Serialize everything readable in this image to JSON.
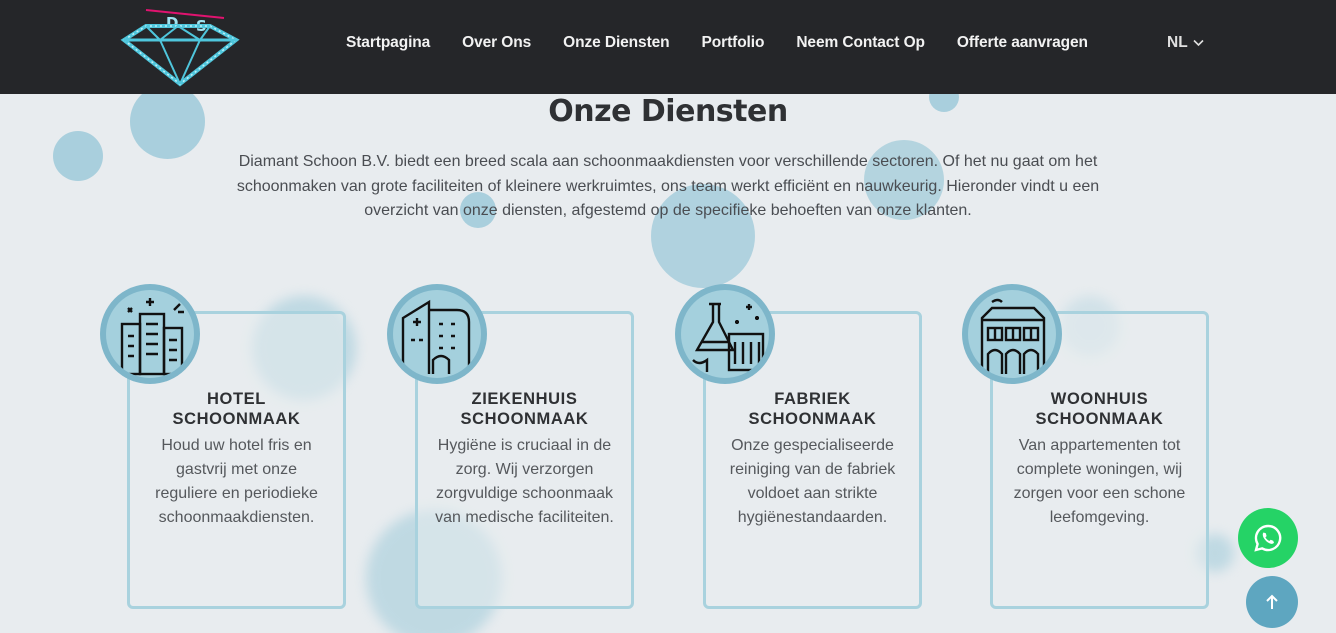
{
  "header": {
    "logo_text": "DS",
    "nav": [
      {
        "label": "Startpagina"
      },
      {
        "label": "Over Ons"
      },
      {
        "label": "Onze Diensten"
      },
      {
        "label": "Portfolio"
      },
      {
        "label": "Neem Contact Op"
      },
      {
        "label": "Offerte aanvragen"
      }
    ],
    "language": "NL",
    "language_icon": "chevron-down-icon"
  },
  "main": {
    "title": "Onze Diensten",
    "intro": "Diamant Schoon B.V. biedt een breed scala aan schoonmaakdiensten voor verschillende sectoren. Of het nu gaat om het schoonmaken van grote faciliteiten of kleinere werkruimtes, ons team werkt efficiënt en nauwkeurig. Hieronder vindt u een overzicht van onze diensten, afgestemd op de specifieke behoeften van onze klanten.",
    "services": [
      {
        "title_line1": "HOTEL",
        "title_line2": "SCHOONMAAK",
        "text": "Houd uw hotel fris en gastvrij met onze reguliere en periodieke schoonmaakdiensten.",
        "icon": "hotel-icon"
      },
      {
        "title_line1": "ZIEKENHUIS",
        "title_line2": "SCHOONMAAK",
        "text": "Hygiëne is cruciaal in de zorg. Wij verzorgen zorgvuldige schoonmaak van medische faciliteiten.",
        "icon": "hospital-icon"
      },
      {
        "title_line1": "FABRIEK",
        "title_line2": "SCHOONMAAK",
        "text": "Onze gespecialiseerde reiniging van de fabriek voldoet aan strikte hygiënestandaarden.",
        "icon": "factory-icon"
      },
      {
        "title_line1": "WOONHUIS",
        "title_line2": "SCHOONMAAK",
        "text": "Van appartementen tot complete woningen, wij zorgen voor een schone leefomgeving.",
        "icon": "house-icon"
      }
    ]
  },
  "floating": {
    "whatsapp_icon": "whatsapp-icon",
    "scroll_top_icon": "arrow-up-icon"
  },
  "colors": {
    "header_bg": "#252629",
    "page_bg": "#e8ecef",
    "accent": "#a9d2de",
    "whatsapp": "#25d366",
    "scroll_top": "#5ea6c0",
    "logo_pink": "#e0136f"
  }
}
